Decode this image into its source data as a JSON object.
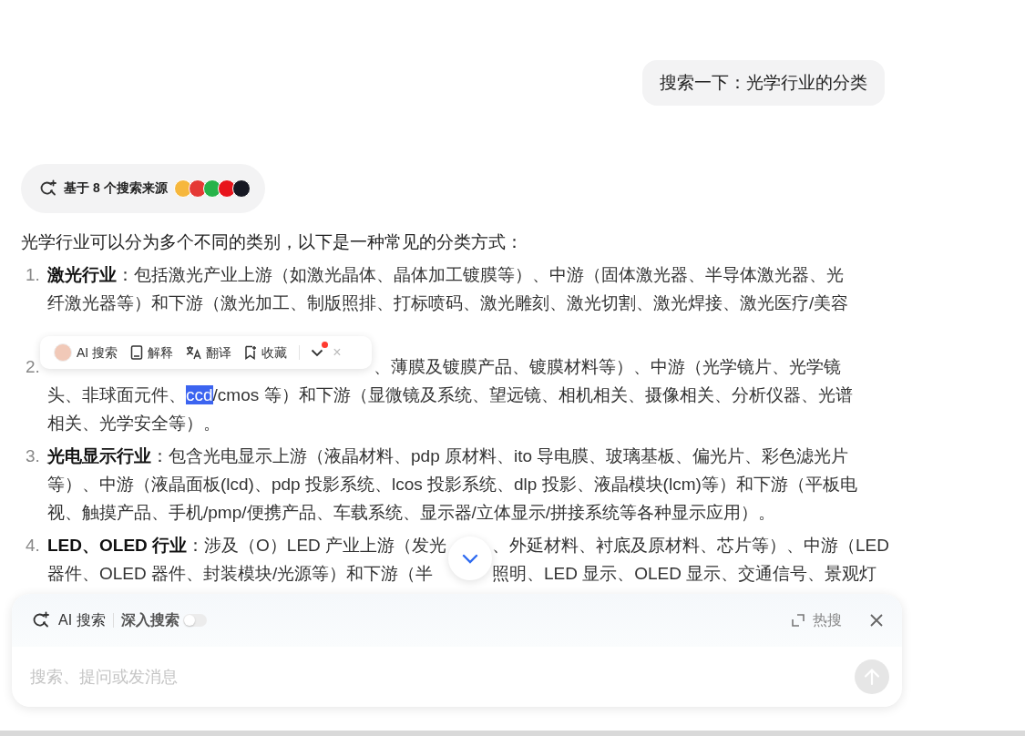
{
  "user_message": {
    "text": "搜索一下：光学行业的分类"
  },
  "sources": {
    "label": "基于 8 个搜索来源",
    "logos": [
      {
        "color": "#f6b73c"
      },
      {
        "color": "#e53935"
      },
      {
        "color": "#27b34a"
      },
      {
        "color": "#e8141c"
      },
      {
        "color": "#161823"
      }
    ]
  },
  "answer": {
    "intro": "光学行业可以分为多个不同的类别，以下是一种常见的分类方式：",
    "items": [
      {
        "number": "1.",
        "lines": [
          [
            {
              "kind": "label",
              "text": "激光行业"
            },
            {
              "kind": "text",
              "text": "：包括激光产业上游（如激光晶体、晶体加工镀膜等）、中游（固体激光器、半导体激光器、光"
            }
          ],
          [
            {
              "kind": "text",
              "text": "纤激光器等）和下游（激光加工、制版照排、打标喷码、激光雕刻、激光切割、激光焊接、激光医疗/美容"
            }
          ]
        ]
      },
      {
        "number": "2.",
        "lines": [
          [
            {
              "kind": "toolbar"
            },
            {
              "kind": "text",
              "text": "、薄膜及镀膜产品、镀膜材料等）、中游（光学镜片、光学镜"
            }
          ],
          [
            {
              "kind": "text",
              "text": "头、非球面元件、"
            },
            {
              "kind": "highlight",
              "text": "ccd"
            },
            {
              "kind": "text",
              "text": "/cmos 等）和下游（显微镜及系统、望远镜、相机相关、摄像相关、分析仪器、光谱"
            }
          ],
          [
            {
              "kind": "text",
              "text": "相关、光学安全等）。"
            }
          ]
        ]
      },
      {
        "number": "3.",
        "lines": [
          [
            {
              "kind": "label",
              "text": "光电显示行业"
            },
            {
              "kind": "text",
              "text": "：包含光电显示上游（液晶材料、pdp 原材料、ito 导电膜、玻璃基板、偏光片、彩色滤光片"
            }
          ],
          [
            {
              "kind": "text",
              "text": "等）、中游（液晶面板(lcd)、pdp 投影系统、lcos 投影系统、dlp 投影、液晶模块(lcm)等）和下游（平板电"
            }
          ],
          [
            {
              "kind": "text",
              "text": "视、触摸产品、手机/pmp/便携产品、车载系统、显示器/立体显示/拼接系统等各种显示应用）。"
            }
          ]
        ]
      },
      {
        "number": "4.",
        "lines": [
          [
            {
              "kind": "label",
              "text": "LED、OLED 行业"
            },
            {
              "kind": "text",
              "text": "：涉及（O）LED 产业上游（发光"
            },
            {
              "kind": "scroll_button"
            },
            {
              "kind": "text",
              "text": "、外延材料、衬底及原材料、芯片等）、中游（LED"
            }
          ],
          [
            {
              "kind": "text",
              "text": "器件、OLED 器件、封装模块/光源等）和下游（半"
            },
            {
              "kind": "gap"
            },
            {
              "kind": "text",
              "text": "照明、LED 显示、OLED 显示、交通信号、景观灯"
            }
          ]
        ]
      }
    ]
  },
  "selection_toolbar": {
    "items": [
      {
        "kind": "avatar",
        "label": "AI 搜索"
      },
      {
        "kind": "doc",
        "label": "解释"
      },
      {
        "kind": "translate",
        "label": "翻译"
      },
      {
        "kind": "bookmark",
        "label": "收藏"
      }
    ],
    "notification": true,
    "close": "×"
  },
  "search_panel": {
    "mode": "AI 搜索",
    "deep_search": {
      "label": "深入搜索",
      "on": false
    },
    "hot": "热搜",
    "placeholder": "搜索、提问或发消息",
    "send_enabled": false
  }
}
